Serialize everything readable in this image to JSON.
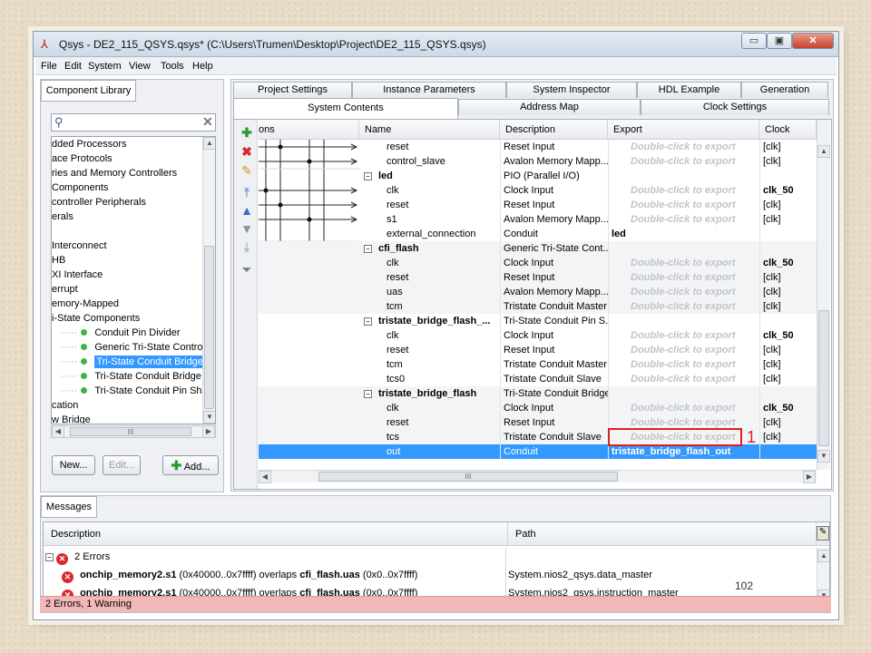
{
  "window": {
    "title": "Qsys - DE2_115_QSYS.qsys* (C:\\Users\\Trumen\\Desktop\\Project\\DE2_115_QSYS.qsys)",
    "min": "▭",
    "max": "▣",
    "close": "✕"
  },
  "menu": [
    "File",
    "Edit",
    "System",
    "View",
    "Tools",
    "Help"
  ],
  "library": {
    "tab": "Component Library",
    "search": "",
    "items": [
      "dded Processors",
      "ace Protocols",
      "ries and Memory Controllers",
      "Components",
      "controller Peripherals",
      "erals",
      "",
      "Interconnect",
      "HB",
      "XI Interface",
      "errupt",
      "emory-Mapped",
      "i-State Components",
      "Conduit Pin Divider",
      "Generic Tri-State Controller",
      "Tri-State Conduit Bridge",
      "Tri-State Conduit Bridge Tra",
      "Tri-State Conduit Pin Sharer",
      "cation",
      "w Bridge"
    ],
    "selected": "Tri-State Conduit Bridge",
    "buttons": {
      "new": "New...",
      "edit": "Edit...",
      "add": "Add..."
    }
  },
  "tabs_top": [
    "Project Settings",
    "Instance Parameters",
    "System Inspector",
    "HDL Example",
    "Generation"
  ],
  "tabs_bottom": [
    "System Contents",
    "Address Map",
    "Clock Settings"
  ],
  "grid": {
    "headers": [
      "ons",
      "Name",
      "Description",
      "Export",
      "Clock"
    ],
    "rows": [
      {
        "type": "port",
        "name": "reset",
        "desc": "Reset Input",
        "export": "Double-click to export",
        "clock": "[clk]"
      },
      {
        "type": "port",
        "name": "control_slave",
        "desc": "Avalon Memory Mapp...",
        "export": "Double-click to export",
        "clock": "[clk]"
      },
      {
        "type": "comp",
        "name": "led",
        "desc": "PIO (Parallel I/O)",
        "export": "",
        "clock": ""
      },
      {
        "type": "port",
        "name": "clk",
        "desc": "Clock Input",
        "export": "Double-click to export",
        "clock": "clk_50"
      },
      {
        "type": "port",
        "name": "reset",
        "desc": "Reset Input",
        "export": "Double-click to export",
        "clock": "[clk]"
      },
      {
        "type": "port",
        "name": "s1",
        "desc": "Avalon Memory Mapp...",
        "export": "Double-click to export",
        "clock": "[clk]"
      },
      {
        "type": "port",
        "name": "external_connection",
        "desc": "Conduit",
        "export": "led",
        "clock": ""
      },
      {
        "type": "comp",
        "name": "cfi_flash",
        "desc": "Generic Tri-State Cont...",
        "export": "",
        "clock": ""
      },
      {
        "type": "port",
        "name": "clk",
        "desc": "Clock Input",
        "export": "Double-click to export",
        "clock": "clk_50"
      },
      {
        "type": "port",
        "name": "reset",
        "desc": "Reset Input",
        "export": "Double-click to export",
        "clock": "[clk]"
      },
      {
        "type": "port",
        "name": "uas",
        "desc": "Avalon Memory Mapp...",
        "export": "Double-click to export",
        "clock": "[clk]"
      },
      {
        "type": "port",
        "name": "tcm",
        "desc": "Tristate Conduit Master",
        "export": "Double-click to export",
        "clock": "[clk]"
      },
      {
        "type": "comp",
        "name": "tristate_bridge_flash_...",
        "desc": "Tri-State Conduit Pin S...",
        "export": "",
        "clock": ""
      },
      {
        "type": "port",
        "name": "clk",
        "desc": "Clock Input",
        "export": "Double-click to export",
        "clock": "clk_50"
      },
      {
        "type": "port",
        "name": "reset",
        "desc": "Reset Input",
        "export": "Double-click to export",
        "clock": "[clk]"
      },
      {
        "type": "port",
        "name": "tcm",
        "desc": "Tristate Conduit Master",
        "export": "Double-click to export",
        "clock": "[clk]"
      },
      {
        "type": "port",
        "name": "tcs0",
        "desc": "Tristate Conduit Slave",
        "export": "Double-click to export",
        "clock": "[clk]"
      },
      {
        "type": "comp",
        "name": "tristate_bridge_flash",
        "desc": "Tri-State Conduit Bridge",
        "export": "",
        "clock": ""
      },
      {
        "type": "port",
        "name": "clk",
        "desc": "Clock Input",
        "export": "Double-click to export",
        "clock": "clk_50"
      },
      {
        "type": "port",
        "name": "reset",
        "desc": "Reset Input",
        "export": "Double-click to export",
        "clock": "[clk]"
      },
      {
        "type": "port",
        "name": "tcs",
        "desc": "Tristate Conduit Slave",
        "export": "Double-click to export",
        "clock": "[clk]"
      },
      {
        "type": "sel",
        "name": "out",
        "desc": "Conduit",
        "export": "tristate_bridge_flash_out",
        "clock": ""
      }
    ]
  },
  "annotation": "1",
  "messages": {
    "tab": "Messages",
    "headers": [
      "Description",
      "Path"
    ],
    "group": "2 Errors",
    "rows": [
      {
        "pre": "onchip_memory2.s1",
        "mid": " (0x40000..0x7ffff) overlaps ",
        "post": "cfi_flash.uas",
        "end": " (0x0..0x7ffff)",
        "path": "System.nios2_qsys.data_master"
      },
      {
        "pre": "onchip_memory2.s1",
        "mid": " (0x40000..0x7ffff) overlaps ",
        "post": "cfi_flash.uas",
        "end": " (0x0..0x7ffff)",
        "path": "System.nios2_qsys.instruction_master"
      }
    ],
    "status": "2 Errors, 1 Warning"
  },
  "page_number": "102",
  "colors": {
    "selection": "#3399ff",
    "status_bg": "#f2b8b8",
    "annotation_box": "#e02020",
    "error": "#d8272e"
  }
}
